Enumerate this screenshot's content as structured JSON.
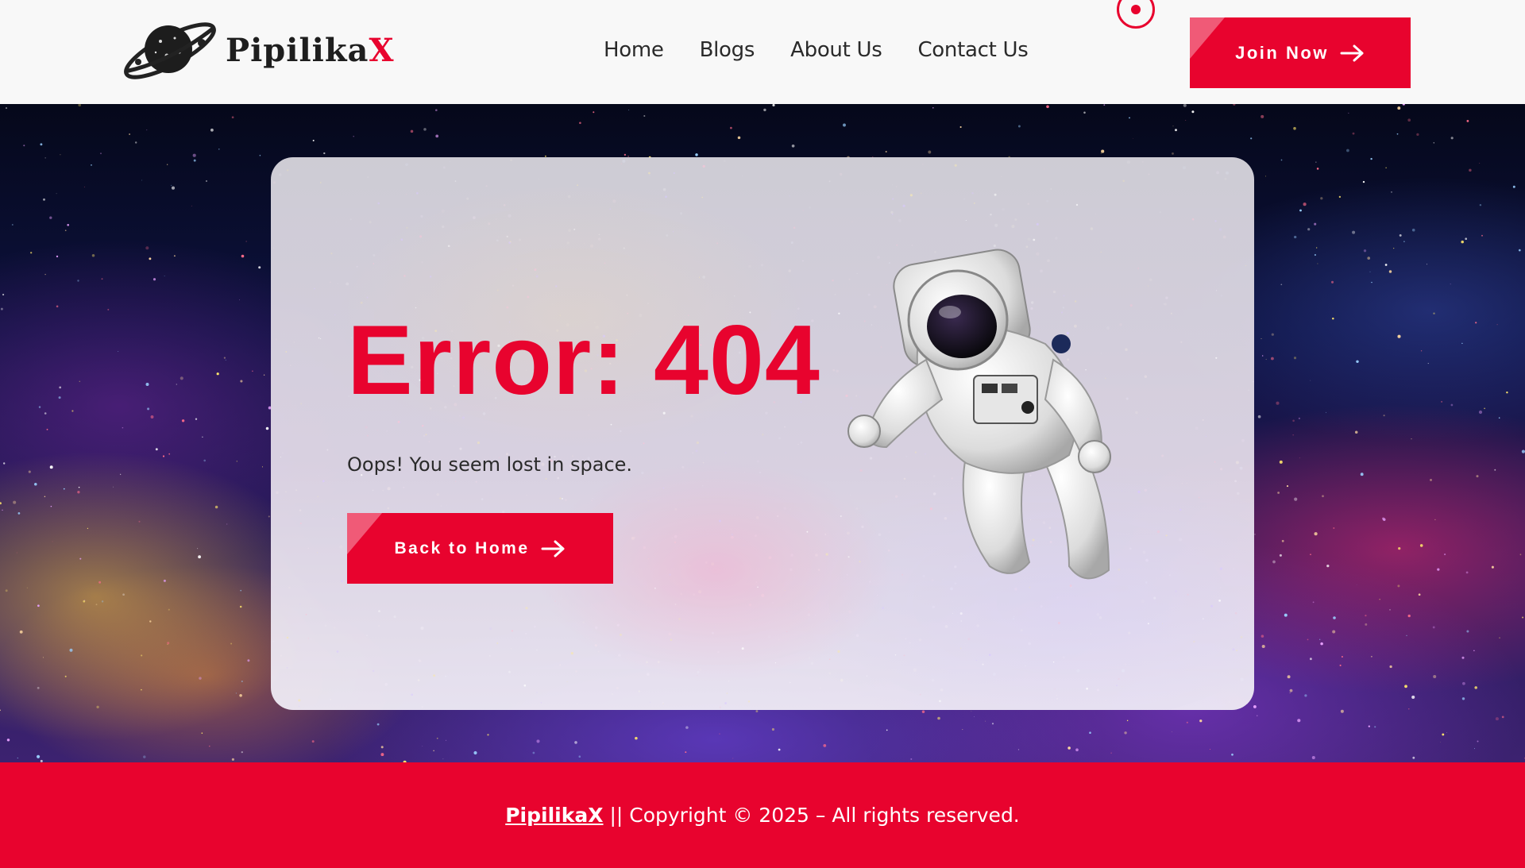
{
  "brand": {
    "name_main": "Pipilika",
    "name_accent": "X"
  },
  "nav": {
    "items": [
      {
        "label": "Home"
      },
      {
        "label": "Blogs"
      },
      {
        "label": "About Us"
      },
      {
        "label": "Contact Us"
      }
    ],
    "join_label": "Join Now"
  },
  "hero": {
    "title": "Error: 404",
    "subtitle": "Oops! You seem lost in space.",
    "back_label": "Back to Home"
  },
  "footer": {
    "brand": "PipilikaX",
    "copyright": " || Copyright © 2025 – All rights reserved."
  },
  "colors": {
    "accent": "#e8032e",
    "header_bg": "#f8f8f8",
    "text": "#2a2a2a"
  },
  "icons": {
    "logo": "planet-logo-icon",
    "arrow": "arrow-right-icon",
    "user": "user-circle-icon"
  }
}
